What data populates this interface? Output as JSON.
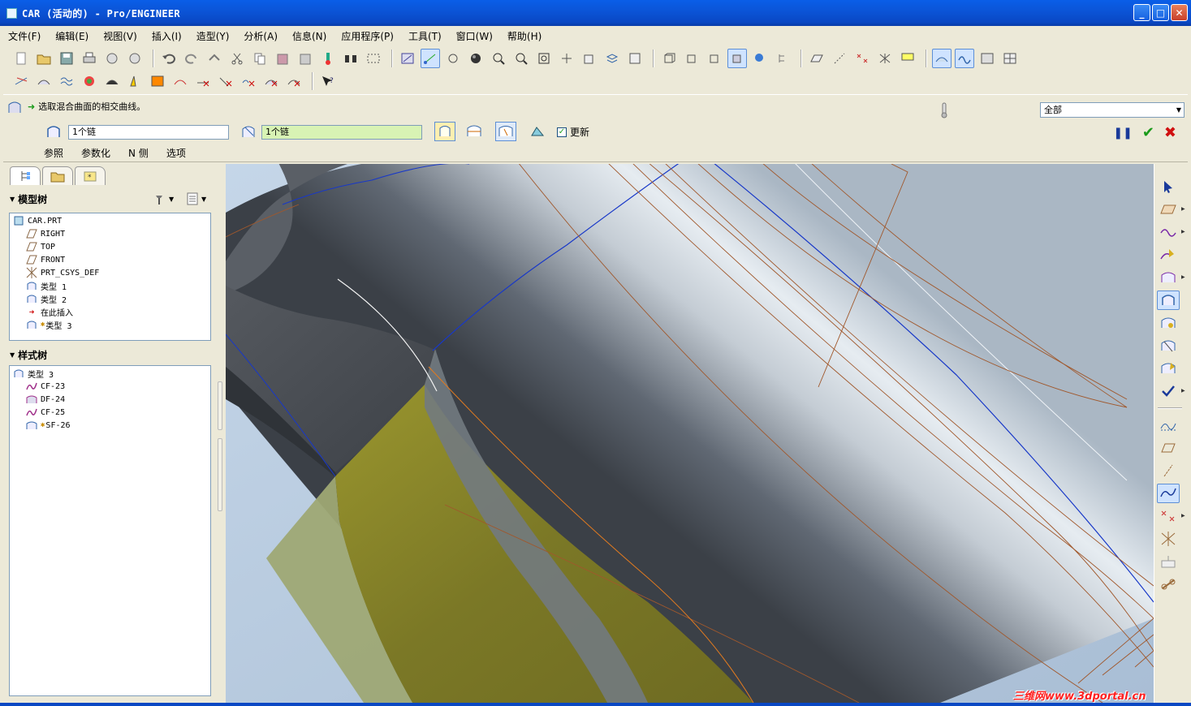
{
  "window": {
    "title": "CAR (活动的) - Pro/ENGINEER",
    "minimize": "_",
    "maximize": "□",
    "close": "✕"
  },
  "menu": [
    "文件(F)",
    "编辑(E)",
    "视图(V)",
    "插入(I)",
    "造型(Y)",
    "分析(A)",
    "信息(N)",
    "应用程序(P)",
    "工具(T)",
    "窗口(W)",
    "帮助(H)"
  ],
  "dashboard": {
    "prompt": "选取混合曲面的相交曲线。",
    "chain_field_1": "1个链",
    "chain_field_2": "1个链",
    "update_label": "更新",
    "update_checked": "✓",
    "tabs": [
      "参照",
      "参数化",
      "N 侧",
      "选项"
    ],
    "filter": "全部",
    "pause": "❚❚",
    "ok": "✔",
    "cancel": "✖"
  },
  "model_tree": {
    "header": "模型树",
    "items": [
      {
        "label": "CAR.PRT",
        "icon": "part-icon"
      },
      {
        "label": "RIGHT",
        "icon": "datum-plane-icon"
      },
      {
        "label": "TOP",
        "icon": "datum-plane-icon"
      },
      {
        "label": "FRONT",
        "icon": "datum-plane-icon"
      },
      {
        "label": "PRT_CSYS_DEF",
        "icon": "csys-icon"
      },
      {
        "label": "类型 1",
        "icon": "style-feature-icon"
      },
      {
        "label": "类型 2",
        "icon": "style-feature-icon"
      },
      {
        "label": "在此插入",
        "icon": "insert-here-icon"
      },
      {
        "label": "类型 3",
        "icon": "style-feature-active-icon"
      }
    ]
  },
  "style_tree": {
    "header": "样式树",
    "items": [
      {
        "label": "类型 3",
        "icon": "style-feature-icon"
      },
      {
        "label": "CF-23",
        "icon": "curve-icon"
      },
      {
        "label": "DF-24",
        "icon": "surface-icon"
      },
      {
        "label": "CF-25",
        "icon": "curve-icon"
      },
      {
        "label": "SF-26",
        "icon": "surface-active-icon"
      }
    ]
  },
  "watermark": "三维网www.3dportal.cn",
  "colors": {
    "titlebar": "#0a55d8",
    "viewport_bg": "#b8c9dc",
    "surface_yellow": "#8f8a2a",
    "curve_brown": "#a0522d",
    "curve_blue": "#1030c0"
  }
}
